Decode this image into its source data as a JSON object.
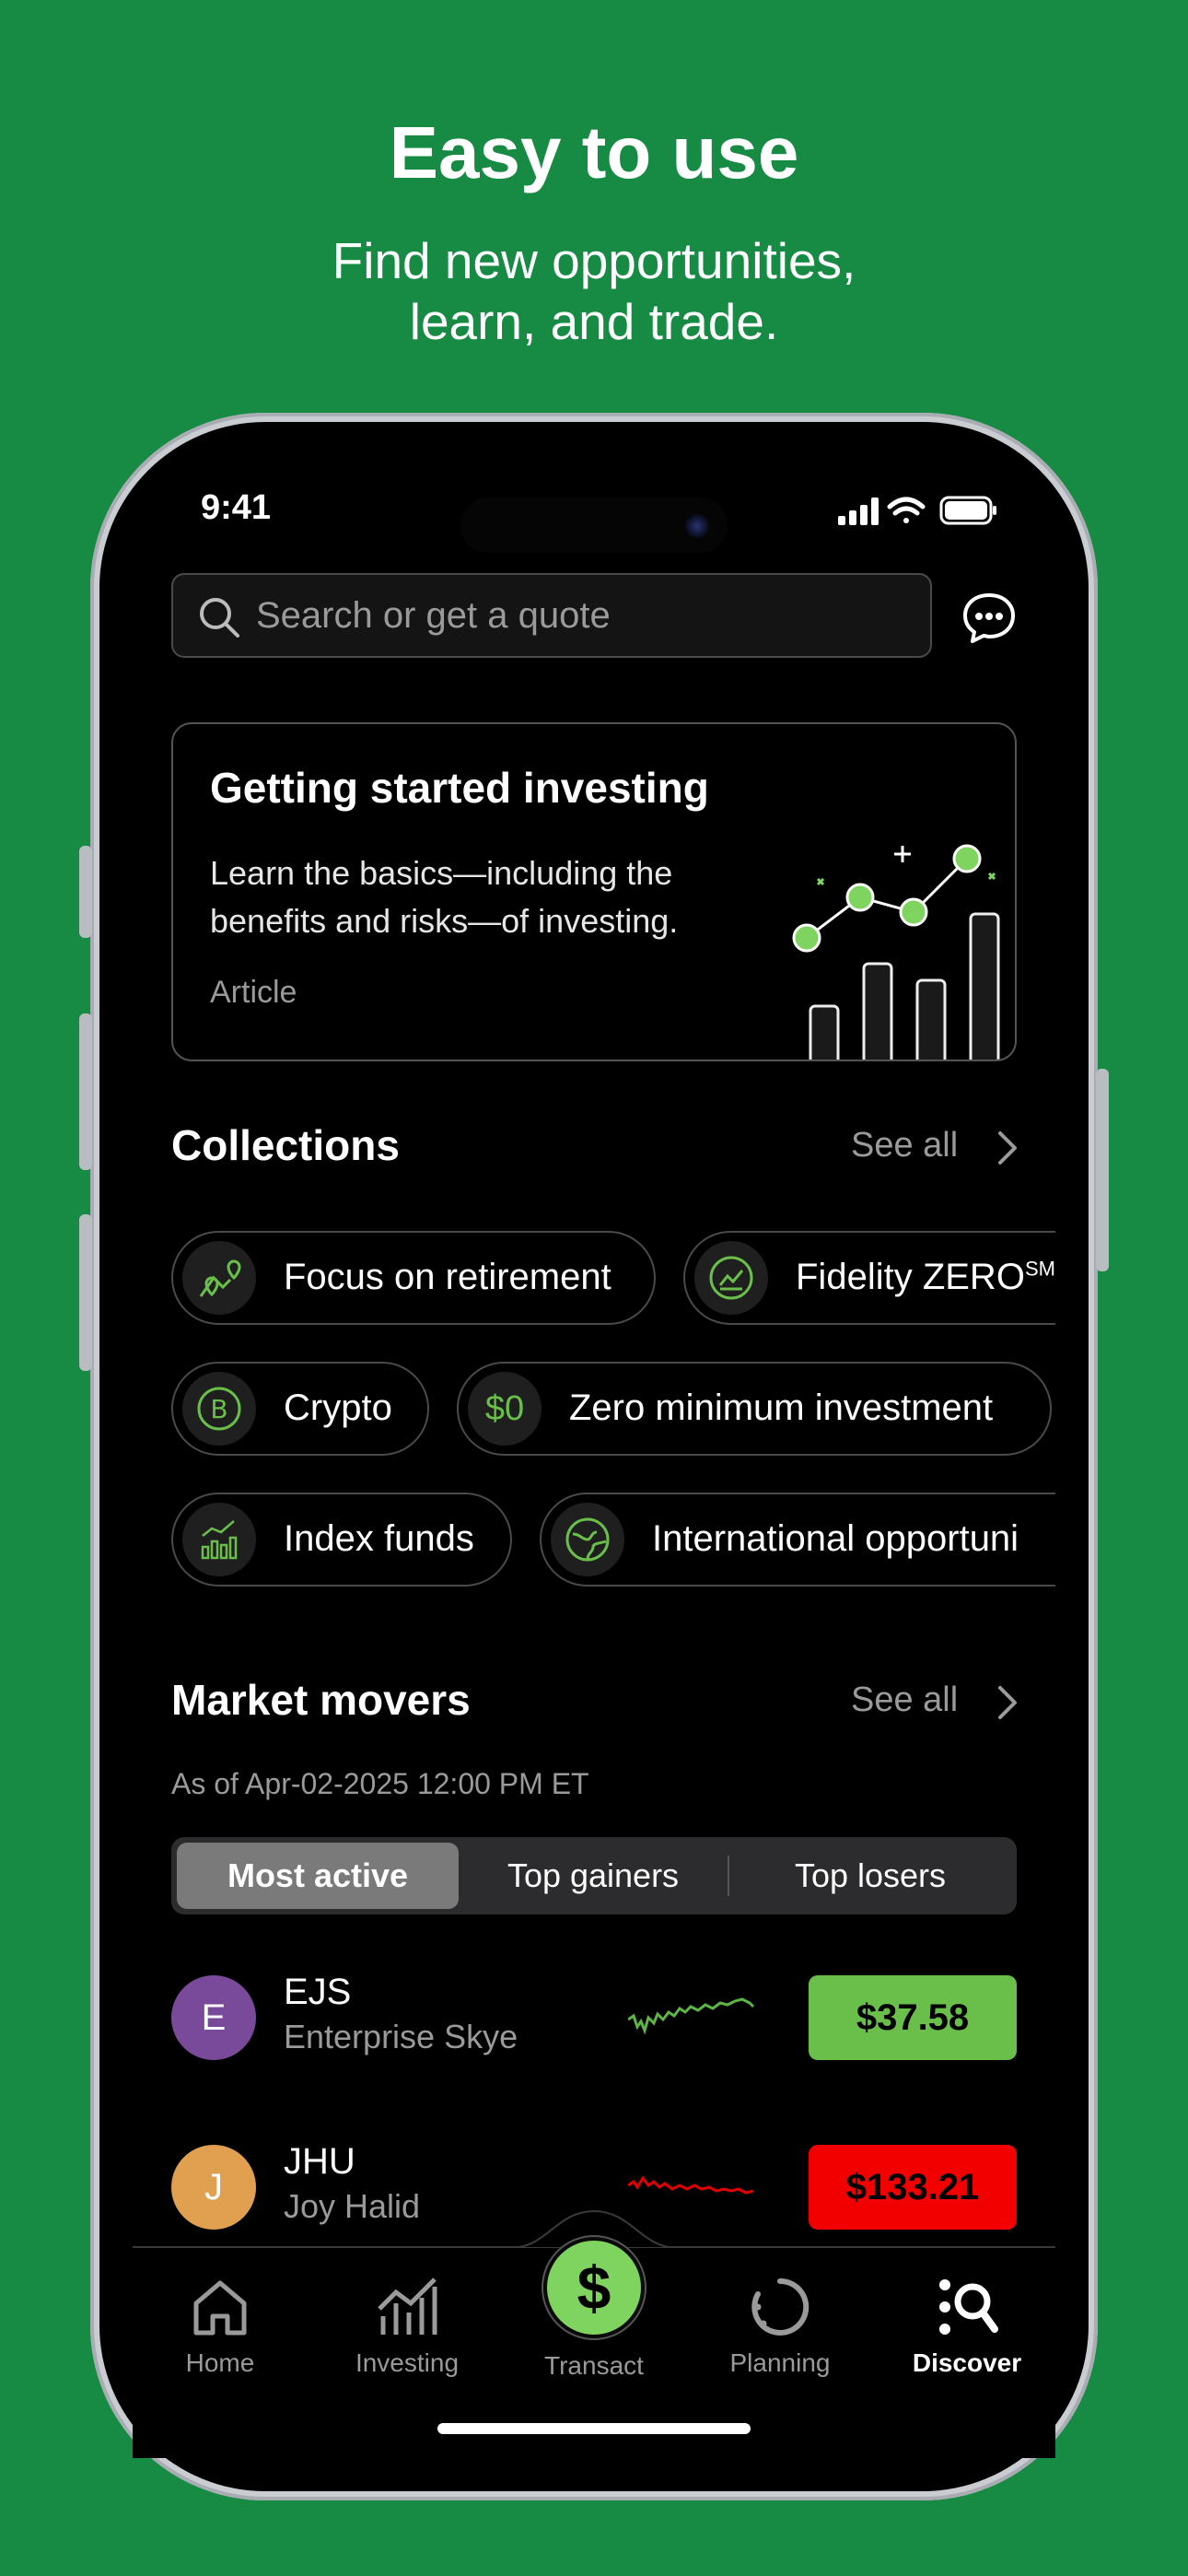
{
  "hero": {
    "title": "Easy to use",
    "subtitle_line1": "Find new opportunities,",
    "subtitle_line2": "learn, and trade."
  },
  "status_bar": {
    "time": "9:41"
  },
  "search": {
    "placeholder": "Search or get a quote"
  },
  "card": {
    "title": "Getting started investing",
    "desc_line1": "Learn the basics—including the",
    "desc_line2": "benefits and risks—of investing.",
    "type": "Article"
  },
  "collections": {
    "title": "Collections",
    "see_all": "See all",
    "chips": [
      {
        "label": "Focus on retirement",
        "icon": "retirement-map-icon"
      },
      {
        "label": "Fidelity ZERO",
        "sup": "SM",
        "icon": "line-chart-icon"
      },
      {
        "label": "Crypto",
        "icon": "bitcoin-icon"
      },
      {
        "label": "Zero minimum investment",
        "icon_text": "$0"
      },
      {
        "label": "Index funds",
        "icon": "bar-trend-icon"
      },
      {
        "label": "International opportuni",
        "icon": "globe-icon"
      }
    ]
  },
  "market_movers": {
    "title": "Market movers",
    "see_all": "See all",
    "as_of": "As of Apr-02-2025 12:00 PM ET",
    "tabs": [
      "Most active",
      "Top gainers",
      "Top losers"
    ],
    "active_tab": "Most active",
    "rows": [
      {
        "initial": "E",
        "ticker": "EJS",
        "name": "Enterprise Skye",
        "price": "$37.58",
        "avatar_color": "#7a4a9a",
        "price_color": "#6abf4b",
        "trend": "up"
      },
      {
        "initial": "J",
        "ticker": "JHU",
        "name": "Joy Halid",
        "price": "$133.21",
        "avatar_color": "#e0a050",
        "price_color": "#f20000",
        "trend": "down"
      }
    ]
  },
  "tabbar": {
    "home": "Home",
    "investing": "Investing",
    "transact": "Transact",
    "transact_symbol": "$",
    "planning": "Planning",
    "discover": "Discover"
  },
  "colors": {
    "background": "#178a43",
    "accent_green": "#7fd45f",
    "loss_red": "#f20000"
  }
}
